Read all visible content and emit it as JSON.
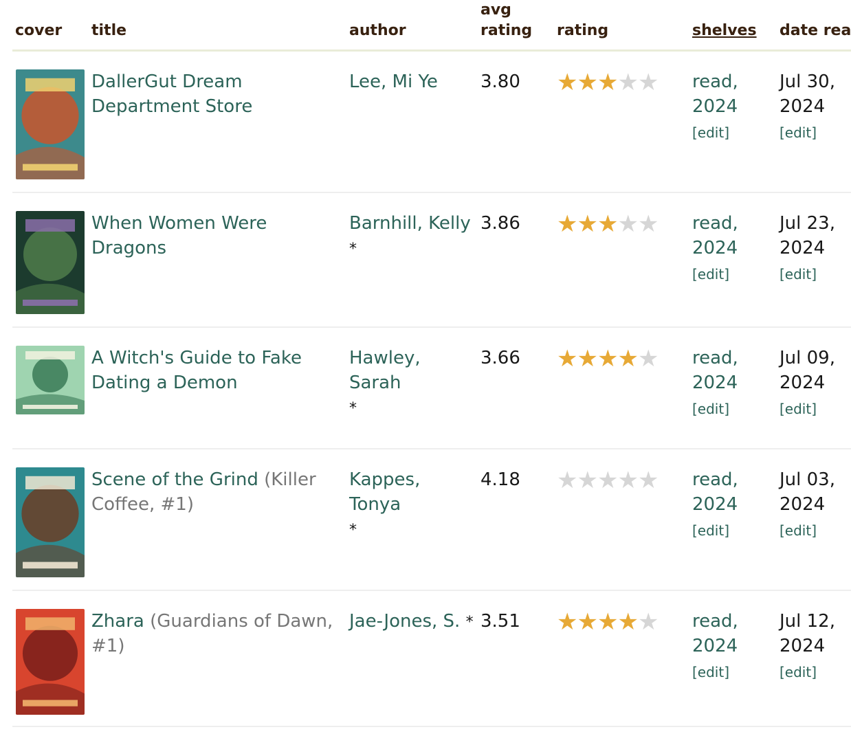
{
  "header": {
    "cover": "cover",
    "title": "title",
    "author": "author",
    "avg_rating_line1": "avg",
    "avg_rating_line2": "rating",
    "rating": "rating",
    "shelves": "shelves",
    "date_read": "date read"
  },
  "books": [
    {
      "title": "DallerGut Dream Department Store",
      "series": "",
      "author": "Lee, Mi Ye",
      "author_star": "",
      "avg_rating": "3.80",
      "rating": 3,
      "shelf_line1": "read,",
      "shelf_line2": "2024",
      "shelf_edit": "[edit]",
      "date_line1": "Jul 30,",
      "date_line2": "2024",
      "date_edit": "[edit]",
      "cover_colors": [
        "#3d8a8c",
        "#c9552c",
        "#f0d070"
      ]
    },
    {
      "title": "When Women Were Dragons",
      "series": "",
      "author": "Barnhill, Kelly",
      "author_star": "*",
      "avg_rating": "3.86",
      "rating": 3,
      "shelf_line1": "read,",
      "shelf_line2": "2024",
      "shelf_edit": "[edit]",
      "date_line1": "Jul 23,",
      "date_line2": "2024",
      "date_edit": "[edit]",
      "cover_colors": [
        "#1c3b2e",
        "#4f7d4a",
        "#8a6fa8"
      ]
    },
    {
      "title": "A Witch's Guide to Fake Dating a Demon",
      "series": "",
      "author": "Hawley, Sarah",
      "author_star": "*",
      "avg_rating": "3.66",
      "rating": 4,
      "shelf_line1": "read,",
      "shelf_line2": "2024",
      "shelf_edit": "[edit]",
      "date_line1": "Jul 09,",
      "date_line2": "2024",
      "date_edit": "[edit]",
      "cover_colors": [
        "#9fd4b0",
        "#3a7a57",
        "#f2f2e0"
      ]
    },
    {
      "title": "Scene of the Grind",
      "series": " (Killer Coffee, #1)",
      "author": "Kappes, Tonya",
      "author_star": "*",
      "avg_rating": "4.18",
      "rating": 0,
      "shelf_line1": "read,",
      "shelf_line2": "2024",
      "shelf_edit": "[edit]",
      "date_line1": "Jul 03,",
      "date_line2": "2024",
      "date_edit": "[edit]",
      "cover_colors": [
        "#2e8a8f",
        "#6b3d26",
        "#efe6d2"
      ]
    },
    {
      "title": "Zhara",
      "series": " (Guardians of Dawn, #1)",
      "author": "Jae-Jones, S.",
      "author_star": "*",
      "avg_rating": "3.51",
      "rating": 4,
      "shelf_line1": "read,",
      "shelf_line2": "2024",
      "shelf_edit": "[edit]",
      "date_line1": "Jul 12,",
      "date_line2": "2024",
      "date_edit": "[edit]",
      "cover_colors": [
        "#d8452e",
        "#7a1f1a",
        "#f1b36b"
      ]
    }
  ],
  "colors": {
    "link": "#2c6358",
    "star_on": "#e7a936",
    "star_off": "#d6d6d6",
    "header_text": "#382110"
  }
}
